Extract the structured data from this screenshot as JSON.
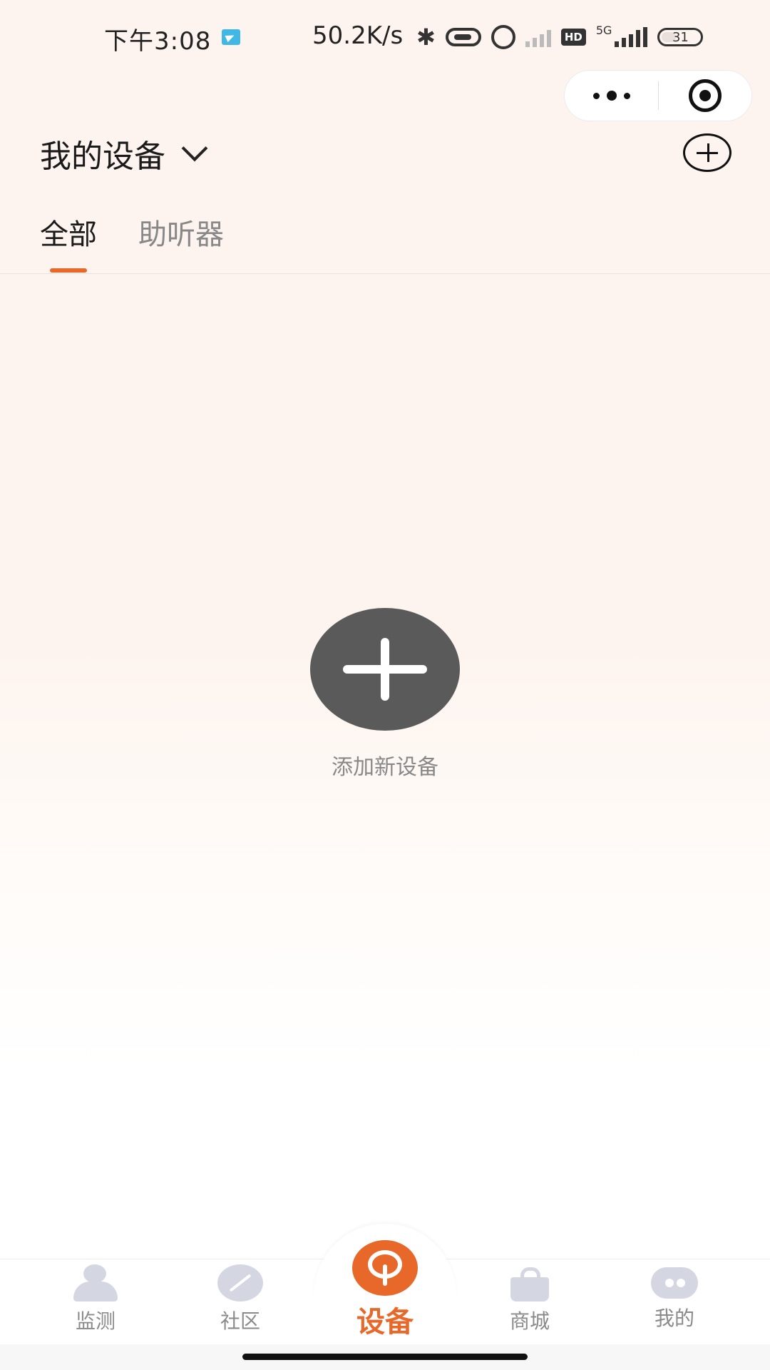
{
  "status_bar": {
    "time": "下午3:08",
    "net_speed": "50.2K/s",
    "network_type": "5G",
    "hd_badge": "HD",
    "battery": "31",
    "icons": [
      "app-notification-icon",
      "bluetooth-icon",
      "vibrate-icon",
      "alarm-icon",
      "signal-sim2-icon",
      "hd-icon",
      "signal-5g-icon",
      "battery-icon"
    ]
  },
  "capsule": {
    "more_icon": "more-dots-icon",
    "close_icon": "close-target-icon"
  },
  "header": {
    "title": "我的设备",
    "dropdown_icon": "chevron-down-icon",
    "add_icon": "add-circle-icon"
  },
  "tabs": [
    {
      "label": "全部",
      "active": true
    },
    {
      "label": "助听器",
      "active": false
    }
  ],
  "empty_state": {
    "add_icon": "add-circle-filled-icon",
    "label": "添加新设备"
  },
  "tabbar": {
    "items": [
      {
        "label": "监测",
        "icon": "person-icon"
      },
      {
        "label": "社区",
        "icon": "community-icon"
      },
      {
        "label": "设备",
        "icon": "device-icon",
        "active": true
      },
      {
        "label": "商城",
        "icon": "shopping-bag-icon"
      },
      {
        "label": "我的",
        "icon": "chat-profile-icon"
      }
    ]
  },
  "colors": {
    "accent": "#e8682a",
    "inactive_icon": "#d4d6e2",
    "background": "#fdf4f0",
    "add_button": "#5a5a5a"
  }
}
